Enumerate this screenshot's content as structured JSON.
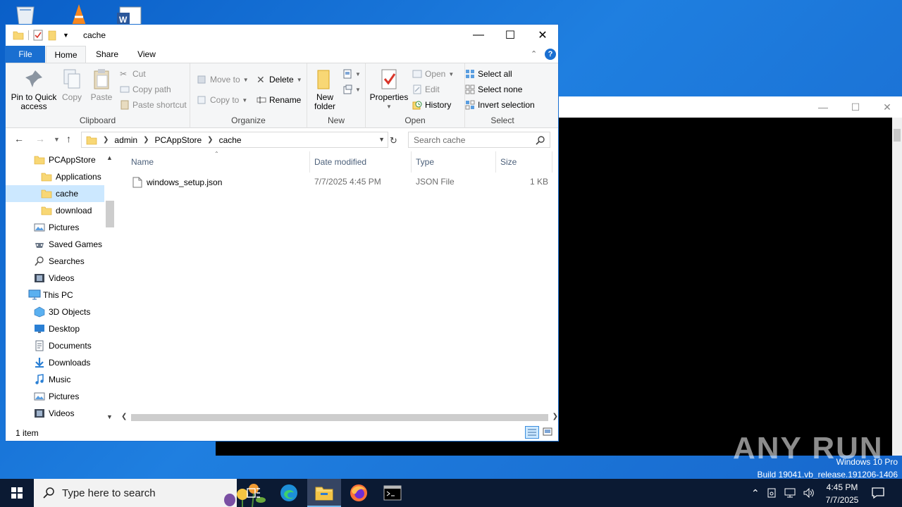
{
  "window": {
    "title": "cache"
  },
  "ribbon": {
    "tabs": {
      "file": "File",
      "home": "Home",
      "share": "Share",
      "view": "View"
    },
    "help": "?",
    "clipboard": {
      "pin": "Pin to Quick access",
      "copy": "Copy",
      "paste": "Paste",
      "cut": "Cut",
      "copy_path": "Copy path",
      "paste_shortcut": "Paste shortcut",
      "label": "Clipboard"
    },
    "organize": {
      "move_to": "Move to",
      "copy_to": "Copy to",
      "delete": "Delete",
      "rename": "Rename",
      "label": "Organize"
    },
    "new": {
      "new_folder": "New folder",
      "label": "New"
    },
    "open": {
      "properties": "Properties",
      "open": "Open",
      "edit": "Edit",
      "history": "History",
      "label": "Open"
    },
    "select": {
      "select_all": "Select all",
      "select_none": "Select none",
      "invert": "Invert selection",
      "label": "Select"
    }
  },
  "address": {
    "crumbs": [
      "admin",
      "PCAppStore",
      "cache"
    ],
    "search_placeholder": "Search cache"
  },
  "nav_pane": {
    "items": [
      {
        "label": "PCAppStore",
        "icon": "folder-icon"
      },
      {
        "label": "Applications",
        "icon": "folder-icon"
      },
      {
        "label": "cache",
        "icon": "folder-icon",
        "selected": true
      },
      {
        "label": "download",
        "icon": "folder-icon"
      },
      {
        "label": "Pictures",
        "icon": "pictures-icon"
      },
      {
        "label": "Saved Games",
        "icon": "saved-games-icon"
      },
      {
        "label": "Searches",
        "icon": "searches-icon"
      },
      {
        "label": "Videos",
        "icon": "videos-icon"
      },
      {
        "label": "This PC",
        "icon": "this-pc-icon"
      },
      {
        "label": "3D Objects",
        "icon": "3d-objects-icon"
      },
      {
        "label": "Desktop",
        "icon": "desktop-icon"
      },
      {
        "label": "Documents",
        "icon": "documents-icon"
      },
      {
        "label": "Downloads",
        "icon": "downloads-icon"
      },
      {
        "label": "Music",
        "icon": "music-icon"
      },
      {
        "label": "Pictures",
        "icon": "pictures-icon"
      },
      {
        "label": "Videos",
        "icon": "videos-icon"
      }
    ]
  },
  "file_list": {
    "columns": {
      "name": "Name",
      "date": "Date modified",
      "type": "Type",
      "size": "Size"
    },
    "rows": [
      {
        "name": "windows_setup.json",
        "date": "7/7/2025 4:45 PM",
        "type": "JSON File",
        "size": "1 KB"
      }
    ]
  },
  "status": {
    "count": "1 item"
  },
  "desktop": {
    "watermark": "ANY RUN",
    "os_edition": "Windows 10 Pro",
    "os_build": "Build 19041.vb_release.191206-1406"
  },
  "taskbar": {
    "search_placeholder": "Type here to search",
    "time": "4:45 PM",
    "date": "7/7/2025"
  },
  "colors": {
    "accent": "#1a6fd1",
    "selection": "#cce8ff",
    "taskbar": "#0b1a33"
  }
}
